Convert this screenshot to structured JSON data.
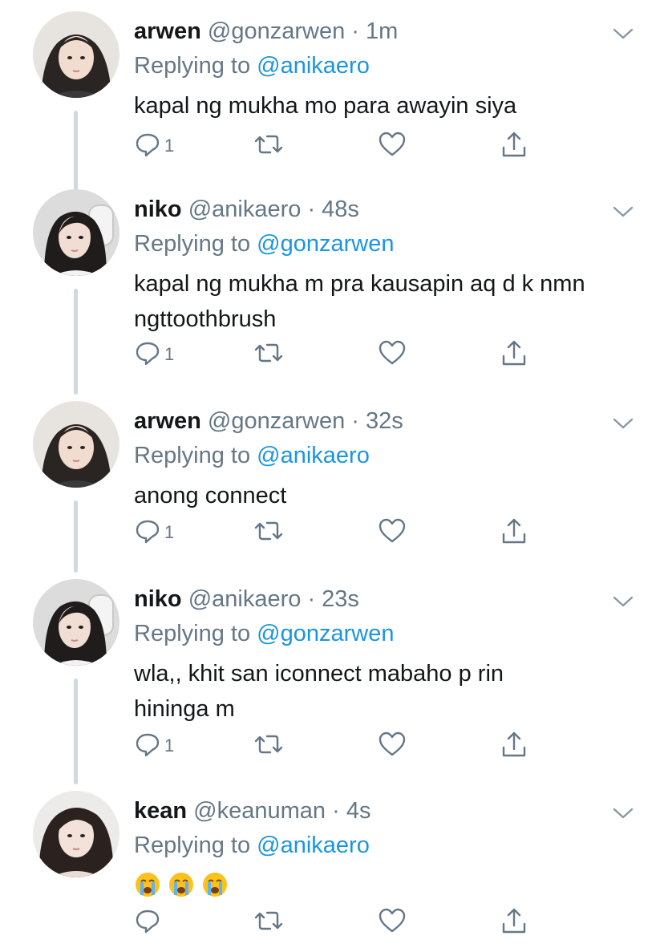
{
  "tweets": [
    {
      "name": "arwen",
      "handle": "@gonzarwen",
      "dot": "·",
      "time": "1m",
      "replying_label": "Replying to",
      "replying_to": "@anikaero",
      "text": "kapal ng mukha mo para awayin siya",
      "reply_count": "1",
      "avatar": "arwen-avatar"
    },
    {
      "name": "niko",
      "handle": "@anikaero",
      "dot": "·",
      "time": "48s",
      "replying_label": "Replying to",
      "replying_to": "@gonzarwen",
      "text": "kapal ng mukha m pra kausapin aq d k nmn ngttoothbrush",
      "reply_count": "1",
      "avatar": "niko-avatar"
    },
    {
      "name": "arwen",
      "handle": "@gonzarwen",
      "dot": "·",
      "time": "32s",
      "replying_label": "Replying to",
      "replying_to": "@anikaero",
      "text": "anong connect",
      "reply_count": "1",
      "avatar": "arwen-avatar"
    },
    {
      "name": "niko",
      "handle": "@anikaero",
      "dot": "·",
      "time": "23s",
      "replying_label": "Replying to",
      "replying_to": "@gonzarwen",
      "text": "wla,, khit san iconnect mabaho p rin hininga m",
      "reply_count": "1",
      "avatar": "niko-avatar"
    },
    {
      "name": "kean",
      "handle": "@keanuman",
      "dot": "·",
      "time": "4s",
      "replying_label": "Replying to",
      "replying_to": "@anikaero",
      "text": "",
      "emoji": [
        "loudly-crying-face",
        "loudly-crying-face",
        "loudly-crying-face"
      ],
      "reply_count": "",
      "avatar": "kean-avatar"
    }
  ],
  "colors": {
    "name": "#14171a",
    "secondary": "#657786",
    "mention": "#1b95e0",
    "icon": "#657786",
    "thread_line": "#cfd9de"
  },
  "icons": [
    "reply-icon",
    "retweet-icon",
    "like-icon",
    "share-icon",
    "chevron-down-icon"
  ]
}
